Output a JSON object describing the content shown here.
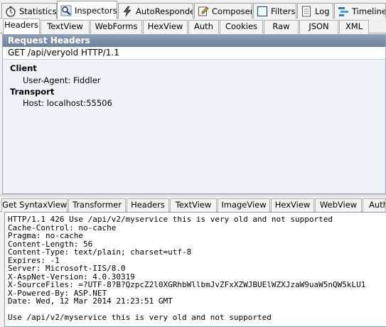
{
  "main_tabs": [
    {
      "label": "Statistics",
      "icon": "stopwatch-icon"
    },
    {
      "label": "Inspectors",
      "icon": "magnifier-icon"
    },
    {
      "label": "AutoResponder",
      "icon": "lightning-icon"
    },
    {
      "label": "Composer",
      "icon": "pencil-icon"
    },
    {
      "label": "Filters",
      "icon": "checkbox-icon"
    },
    {
      "label": "Log",
      "icon": "document-icon"
    },
    {
      "label": "Timeline",
      "icon": "timeline-icon"
    }
  ],
  "request_tabs": [
    "Headers",
    "TextView",
    "WebForms",
    "HexView",
    "Auth",
    "Cookies",
    "Raw",
    "JSON",
    "XML"
  ],
  "request": {
    "title": "Request Headers",
    "request_line": "GET /api/veryold HTTP/1.1",
    "groups": [
      {
        "name": "Client",
        "headers": [
          "User-Agent: Fiddler"
        ]
      },
      {
        "name": "Transport",
        "headers": [
          "Host: localhost:55506"
        ]
      }
    ]
  },
  "response_tabs": [
    "Get SyntaxView",
    "Transformer",
    "Headers",
    "TextView",
    "ImageView",
    "HexView",
    "WebView",
    "Auth"
  ],
  "response": {
    "lines": [
      "HTTP/1.1 426 Use /api/v2/myservice this is very old and not supported",
      "Cache-Control: no-cache",
      "Pragma: no-cache",
      "Content-Length: 56",
      "Content-Type: text/plain; charset=utf-8",
      "Expires: -1",
      "Server: Microsoft-IIS/8.0",
      "X-AspNet-Version: 4.0.30319",
      "X-SourceFiles: =?UTF-8?B?QzpcZ2l0XGRhbWllbmJvZFxXZWJBUElWZXJzaW9uaW5nQW5kLU1",
      "X-Powered-By: ASP.NET",
      "Date: Wed, 12 Mar 2014 21:23:51 GMT",
      "",
      "Use /api/v2/myservice this is very old and not supported"
    ]
  },
  "colors": {
    "panel_title_bg": "#7f90a9",
    "panel_bg": "#eef3fa",
    "tab_active_bg": "#ffffff"
  }
}
